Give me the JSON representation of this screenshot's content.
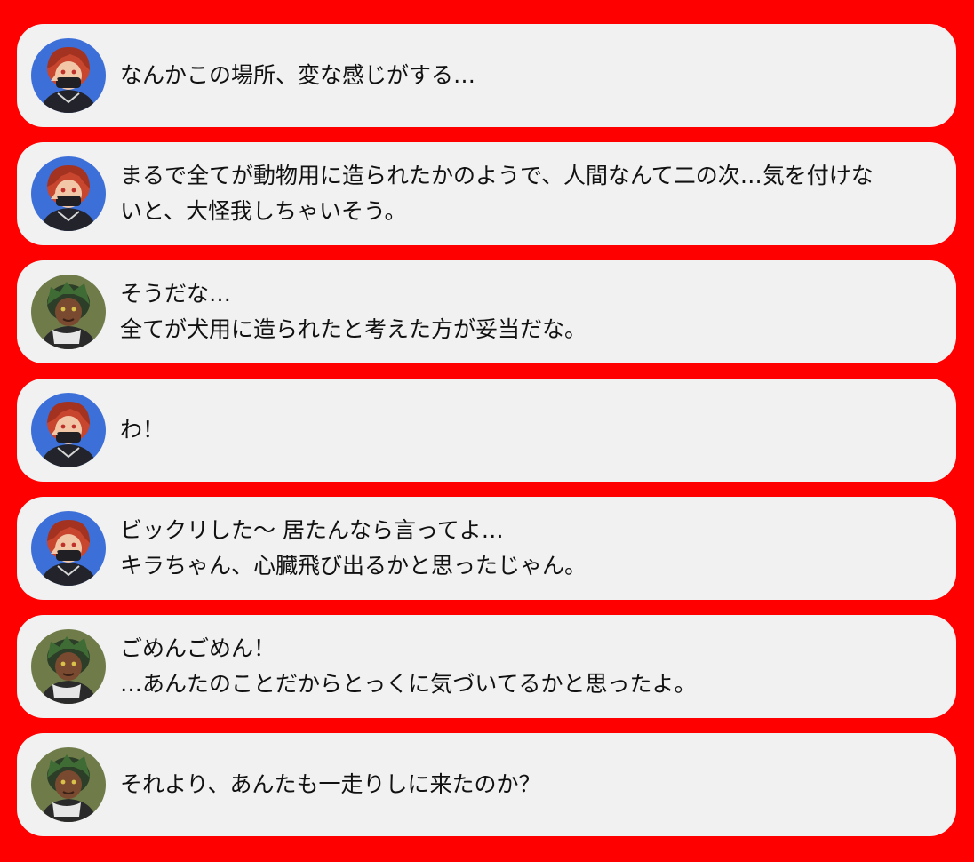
{
  "colors": {
    "background": "#ff0000",
    "bubble": "#f1f1f1",
    "text": "#111111",
    "avatar_red_bg": "#3d6fd8",
    "avatar_green_bg": "#6f7c4a"
  },
  "messages": [
    {
      "speaker_avatar": "red-haired-character-avatar",
      "lines": [
        "なんかこの場所、変な感じがする…"
      ]
    },
    {
      "speaker_avatar": "red-haired-character-avatar",
      "lines": [
        "まるで全てが動物用に造られたかのようで、人間なんて二の次…気を付けな",
        "いと、大怪我しちゃいそう。"
      ]
    },
    {
      "speaker_avatar": "green-haired-character-avatar",
      "lines": [
        "そうだな…",
        "全てが犬用に造られたと考えた方が妥当だな。"
      ]
    },
    {
      "speaker_avatar": "red-haired-character-avatar",
      "lines": [
        "わ！"
      ]
    },
    {
      "speaker_avatar": "red-haired-character-avatar",
      "lines": [
        "ビックリした～ 居たんなら言ってよ…",
        "キラちゃん、心臓飛び出るかと思ったじゃん。"
      ]
    },
    {
      "speaker_avatar": "green-haired-character-avatar",
      "lines": [
        "ごめんごめん！",
        "…あんたのことだからとっくに気づいてるかと思ったよ。"
      ]
    },
    {
      "speaker_avatar": "green-haired-character-avatar",
      "lines": [
        "それより、あんたも一走りしに来たのか？"
      ]
    }
  ]
}
